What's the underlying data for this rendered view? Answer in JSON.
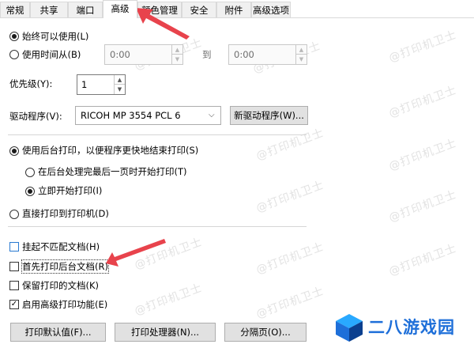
{
  "tabs": [
    {
      "label": "常规"
    },
    {
      "label": "共享"
    },
    {
      "label": "端口"
    },
    {
      "label": "高级"
    },
    {
      "label": "颜色管理"
    },
    {
      "label": "安全"
    },
    {
      "label": "附件"
    },
    {
      "label": "高级选项"
    }
  ],
  "availability": {
    "always_label": "始终可以使用(L)",
    "from_label": "使用时间从(B)",
    "from_time": "0:00",
    "to_label": "到",
    "to_time": "0:00"
  },
  "priority": {
    "label": "优先级(Y):",
    "value": "1"
  },
  "driver": {
    "label": "驱动程序(V):",
    "selected": "RICOH MP 3554 PCL 6",
    "new_driver_button": "新驱动程序(W)..."
  },
  "spool": {
    "spool_label": "使用后台打印，以便程序更快地结束打印(S)",
    "after_last_page_label": "在后台处理完最后一页时开始打印(T)",
    "immediately_label": "立即开始打印(I)",
    "direct_label": "直接打印到打印机(D)"
  },
  "options": {
    "hold_mismatched": "挂起不匹配文档(H)",
    "print_spooled_first": "首先打印后台文档(R)",
    "keep_printed": "保留打印的文档(K)",
    "enable_advanced": "启用高级打印功能(E)"
  },
  "buttons": {
    "defaults": "打印默认值(F)...",
    "processor": "打印处理器(N)...",
    "separator": "分隔页(O)..."
  },
  "watermark": {
    "text": "@打印机卫士"
  },
  "logo": {
    "text": "二八游戏园"
  },
  "colors": {
    "arrow": "#e8434c",
    "logo_blue": "#1e6fd9"
  }
}
